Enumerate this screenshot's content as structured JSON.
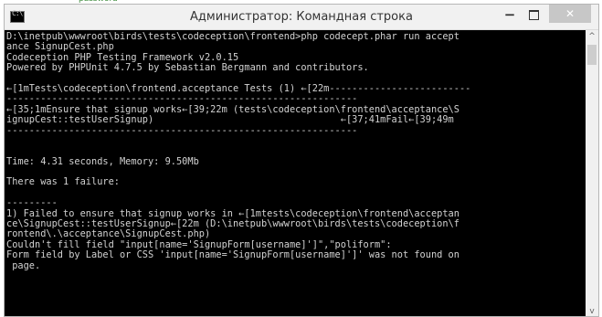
{
  "background_doc": {
    "partial_text": "password"
  },
  "window": {
    "title": "Администратор: Командная строка",
    "icon": "cmd-icon",
    "icon_prompt": "C:\\",
    "controls": {
      "minimize": "−",
      "maximize": "",
      "close": "✕"
    },
    "close_color": "#c7c7c7"
  },
  "console": {
    "background": "#000000",
    "foreground": "#d2d2d2",
    "lines": [
      "D:\\inetpub\\wwwroot\\birds\\tests\\codeception\\frontend>php codecept.phar run accept",
      "ance SignupCest.php",
      "Codeception PHP Testing Framework v2.0.15",
      "Powered by PHPUnit 4.7.5 by Sebastian Bergmann and contributors.",
      "",
      "←[1mTests\\codeception\\frontend.acceptance Tests (1) ←[22m-------------------------",
      "--------------------------------------------------------------",
      "←[35;1mEnsure that signup works←[39;22m (tests\\codeception\\frontend\\acceptance\\S",
      "ignupCest::testUserSignup)                                 ←[37;41mFail←[39;49m",
      "--------------------------------------------------------------",
      "",
      "",
      "Time: 4.31 seconds, Memory: 9.50Mb",
      "",
      "There was 1 failure:",
      "",
      "---------",
      "1) Failed to ensure that signup works in ←[1mtests\\codeception\\frontend\\acceptan",
      "ce\\SignupCest::testUserSignup←[22m (D:\\inetpub\\wwwroot\\birds\\tests\\codeception\\f",
      "rontend\\.\\acceptance\\SignupCest.php)",
      "Couldn't fill field \"input[name='SignupForm[username]']\",\"poliform\":",
      "Form field by Label or CSS 'input[name='SignupForm[username]']' was not found on",
      " page."
    ]
  },
  "scrollbar": {
    "up_arrow": "^",
    "down_arrow": "v"
  }
}
